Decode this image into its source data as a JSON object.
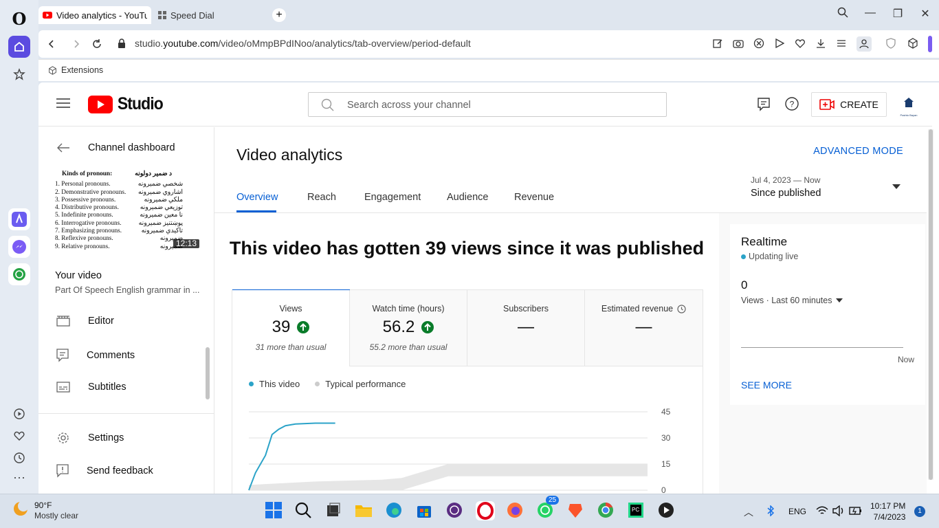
{
  "browser": {
    "tabs": [
      {
        "label": "Video analytics - YouTube"
      },
      {
        "label": "Speed Dial"
      }
    ],
    "url_prefix": "studio.",
    "url_domain": "youtube.com",
    "url_path": "/video/oMmpBPdINoo/analytics/tab-overview/period-default",
    "bookmarks": {
      "extensions_label": "Extensions"
    }
  },
  "studio": {
    "brand": "Studio",
    "search_placeholder": "Search across your channel",
    "create_label": "CREATE",
    "avatar_text": "Pashto Bayan"
  },
  "nav": {
    "back_label": "Channel dashboard",
    "thumbnail": {
      "title": "Kinds of pronoun:",
      "title_rtl": "د ضمير دولونه",
      "duration": "12:13",
      "rows": [
        {
          "en": "1. Personal pronouns.",
          "ps": "شخصي ضميرونه"
        },
        {
          "en": "2. Demonstrative pronouns.",
          "ps": "اشاروي ضميرونه"
        },
        {
          "en": "3. Possessive pronouns.",
          "ps": "ملكي ضميرونه"
        },
        {
          "en": "4. Distributive pronouns.",
          "ps": "توزيعي ضميرونه"
        },
        {
          "en": "5. Indefinite pronouns.",
          "ps": "نا معين ضميرونه"
        },
        {
          "en": "6. Interrogative pronouns.",
          "ps": "پوښتنيز ضميرونه"
        },
        {
          "en": "7. Emphasizing pronouns.",
          "ps": "تاكيدي ضميرونه"
        },
        {
          "en": "8. Reflexive pronouns.",
          "ps": "ضميرونه"
        },
        {
          "en": "9. Relative pronouns.",
          "ps": "ضميرونه"
        }
      ]
    },
    "your_video_label": "Your video",
    "video_title": "Part Of Speech English grammar in ...",
    "items": [
      {
        "label": "Editor"
      },
      {
        "label": "Comments"
      },
      {
        "label": "Subtitles"
      },
      {
        "label": "Settings"
      },
      {
        "label": "Send feedback"
      }
    ]
  },
  "main": {
    "title": "Video analytics",
    "advanced_mode": "ADVANCED MODE",
    "tabs": [
      "Overview",
      "Reach",
      "Engagement",
      "Audience",
      "Revenue"
    ],
    "active_tab": "Overview",
    "date_range": {
      "range": "Jul 4, 2023 — Now",
      "label": "Since published"
    },
    "headline": "This video has gotten 39 views since it was published",
    "metrics": [
      {
        "label": "Views",
        "value": "39",
        "up": true,
        "sub": "31 more than usual"
      },
      {
        "label": "Watch time (hours)",
        "value": "56.2",
        "up": true,
        "sub": "55.2 more than usual"
      },
      {
        "label": "Subscribers",
        "value": "—",
        "up": false,
        "sub": ""
      },
      {
        "label": "Estimated revenue",
        "value": "—",
        "up": false,
        "sub": ""
      }
    ],
    "legend": {
      "this_video": "This video",
      "typical": "Typical performance"
    }
  },
  "chart_data": {
    "type": "line",
    "series": [
      {
        "name": "This video",
        "x": [
          0,
          0.1,
          0.25,
          0.35,
          0.45,
          0.55,
          0.7,
          1.0,
          1.3
        ],
        "y": [
          0,
          10,
          20,
          32,
          35,
          37,
          38,
          38.5,
          38.5
        ]
      },
      {
        "name": "Typical performance",
        "x": [
          0,
          1,
          2,
          2.3,
          3,
          4,
          5,
          6
        ],
        "y": [
          3,
          5,
          6,
          7,
          15,
          15,
          15,
          15
        ]
      }
    ],
    "y_ticks": [
      "0",
      "15",
      "30",
      "45"
    ],
    "ylim": [
      0,
      45
    ],
    "colors": {
      "this_video": "#2ba3c8",
      "typical": "#e6e6e6"
    }
  },
  "realtime": {
    "title": "Realtime",
    "status": "Updating live",
    "value": "0",
    "metric": "Views · Last 60 minutes",
    "axis_label": "Now",
    "see_more": "SEE MORE"
  },
  "taskbar": {
    "weather_temp": "90°F",
    "weather_desc": "Mostly clear",
    "language": "ENG",
    "time": "10:17 PM",
    "date": "7/4/2023",
    "notification_count": "1",
    "whatsapp_badge": "25"
  }
}
